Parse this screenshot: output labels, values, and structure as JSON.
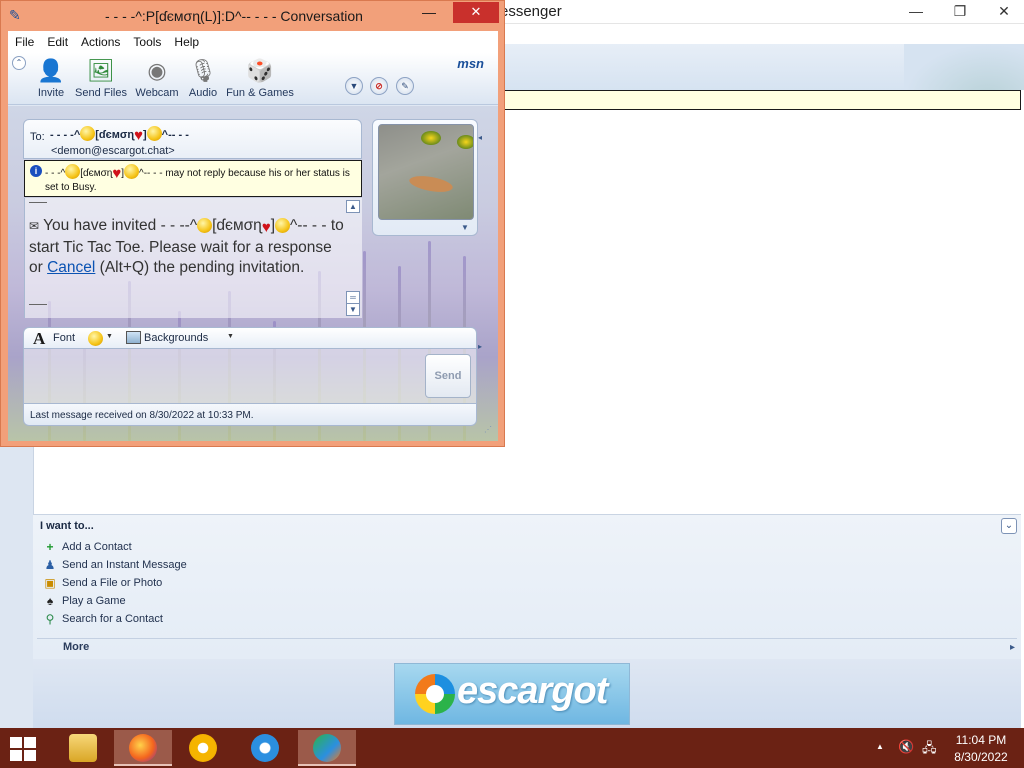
{
  "messenger": {
    "title": "essenger",
    "controls": {
      "minimize": "—",
      "maximize": "❐",
      "close": "✕"
    },
    "i_want_to": {
      "title": "I want to...",
      "tasks": [
        {
          "label": "Add a Contact",
          "icon": "add-contact-icon"
        },
        {
          "label": "Send an Instant Message",
          "icon": "instant-message-icon"
        },
        {
          "label": "Send a File or Photo",
          "icon": "send-file-icon"
        },
        {
          "label": "Play a Game",
          "icon": "game-icon"
        },
        {
          "label": "Search for a Contact",
          "icon": "search-contact-icon"
        }
      ],
      "more": "More"
    },
    "banner_text": "escargot"
  },
  "conversation": {
    "title": "- - - -^:P[ɗємσɳ(L)]:D^-- - - - Conversation",
    "controls": {
      "minimize": "—",
      "close": "✕"
    },
    "menu": [
      "File",
      "Edit",
      "Actions",
      "Tools",
      "Help"
    ],
    "toolbar": [
      {
        "label": "Invite",
        "icon": "invite-icon"
      },
      {
        "label": "Send Files",
        "icon": "send-files-icon"
      },
      {
        "label": "Webcam",
        "icon": "webcam-icon"
      },
      {
        "label": "Audio",
        "icon": "audio-icon"
      },
      {
        "label": "Fun & Games",
        "icon": "fun-games-icon"
      }
    ],
    "brand": "msn",
    "to": {
      "label": "To:",
      "name_prefix": "- - - -^",
      "name_core": "[ɗємσɳ",
      "name_close": "]",
      "name_suffix": "^-- - -",
      "email": "<demon@escargot.chat>"
    },
    "busy_notice": {
      "prefix": "- - -^",
      "name_core": "[ɗємσɳ",
      "name_close": "]",
      "text": "^-- - - may not reply because his or her status is set to Busy."
    },
    "message": {
      "part1": "You have invited - - --^",
      "name_core": "[ɗємσɳ",
      "name_close": "]",
      "part2": "^-- - - to start Tic Tac Toe. Please wait for a response or",
      "link": "Cancel",
      "part3": "(Alt+Q) the pending invitation."
    },
    "format_bar": {
      "font": "Font",
      "backgrounds": "Backgrounds"
    },
    "send_label": "Send",
    "status": "Last message received on 8/30/2022 at 10:33 PM."
  },
  "taskbar": {
    "apps": [
      "File Explorer",
      "Firefox",
      "Chrome",
      "Internet Explorer",
      "Windows Live Messenger"
    ],
    "time": "11:04 PM",
    "date": "8/30/2022"
  }
}
